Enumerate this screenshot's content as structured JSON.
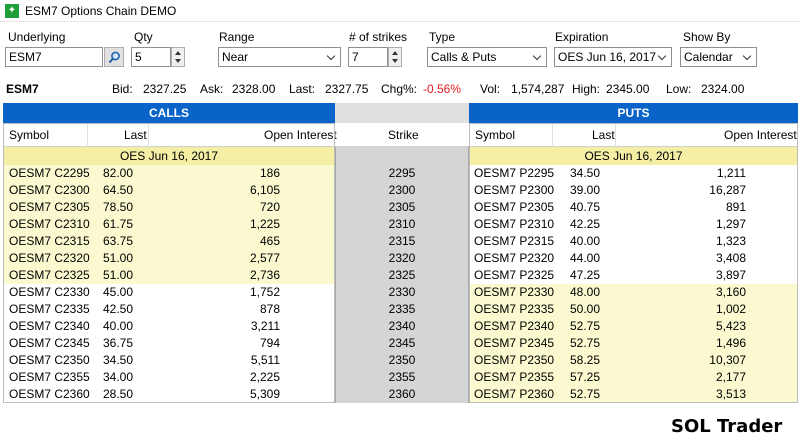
{
  "window": {
    "title": "ESM7 Options Chain DEMO",
    "icon": "app-icon"
  },
  "controls": {
    "underlying": {
      "label": "Underlying",
      "value": "ESM7"
    },
    "qty": {
      "label": "Qty",
      "value": "5"
    },
    "range": {
      "label": "Range",
      "value": "Near"
    },
    "strikes": {
      "label": "# of strikes",
      "value": "7"
    },
    "type": {
      "label": "Type",
      "value": "Calls & Puts"
    },
    "expiration": {
      "label": "Expiration",
      "value": "OES Jun 16, 2017"
    },
    "show_by": {
      "label": "Show By",
      "value": "Calendar"
    }
  },
  "quote": {
    "symbol": "ESM7",
    "bid_label": "Bid:",
    "bid": "2327.25",
    "ask_label": "Ask:",
    "ask": "2328.00",
    "last_label": "Last:",
    "last": "2327.75",
    "chg_label": "Chg%:",
    "chg": "-0.56%",
    "vol_label": "Vol:",
    "vol": "1,574,287",
    "high_label": "High:",
    "high": "2345.00",
    "low_label": "Low:",
    "low": "2324.00"
  },
  "headers": {
    "calls": "CALLS",
    "puts": "PUTS",
    "symbol": "Symbol",
    "last": "Last",
    "open_interest": "Open Interest",
    "strike": "Strike"
  },
  "expiry_label": "OES Jun 16, 2017",
  "rows": [
    {
      "strike": "2295",
      "call_symbol": "OESM7 C2295",
      "call_last": "82.00",
      "call_oi": "186",
      "put_symbol": "OESM7 P2295",
      "put_last": "34.50",
      "put_oi": "1,211"
    },
    {
      "strike": "2300",
      "call_symbol": "OESM7 C2300",
      "call_last": "64.50",
      "call_oi": "6,105",
      "put_symbol": "OESM7 P2300",
      "put_last": "39.00",
      "put_oi": "16,287"
    },
    {
      "strike": "2305",
      "call_symbol": "OESM7 C2305",
      "call_last": "78.50",
      "call_oi": "720",
      "put_symbol": "OESM7 P2305",
      "put_last": "40.75",
      "put_oi": "891"
    },
    {
      "strike": "2310",
      "call_symbol": "OESM7 C2310",
      "call_last": "61.75",
      "call_oi": "1,225",
      "put_symbol": "OESM7 P2310",
      "put_last": "42.25",
      "put_oi": "1,297"
    },
    {
      "strike": "2315",
      "call_symbol": "OESM7 C2315",
      "call_last": "63.75",
      "call_oi": "465",
      "put_symbol": "OESM7 P2315",
      "put_last": "40.00",
      "put_oi": "1,323"
    },
    {
      "strike": "2320",
      "call_symbol": "OESM7 C2320",
      "call_last": "51.00",
      "call_oi": "2,577",
      "put_symbol": "OESM7 P2320",
      "put_last": "44.00",
      "put_oi": "3,408"
    },
    {
      "strike": "2325",
      "call_symbol": "OESM7 C2325",
      "call_last": "51.00",
      "call_oi": "2,736",
      "put_symbol": "OESM7 P2325",
      "put_last": "47.25",
      "put_oi": "3,897"
    },
    {
      "strike": "2330",
      "call_symbol": "OESM7 C2330",
      "call_last": "45.00",
      "call_oi": "1,752",
      "put_symbol": "OESM7 P2330",
      "put_last": "48.00",
      "put_oi": "3,160"
    },
    {
      "strike": "2335",
      "call_symbol": "OESM7 C2335",
      "call_last": "42.50",
      "call_oi": "878",
      "put_symbol": "OESM7 P2335",
      "put_last": "50.00",
      "put_oi": "1,002"
    },
    {
      "strike": "2340",
      "call_symbol": "OESM7 C2340",
      "call_last": "40.00",
      "call_oi": "3,211",
      "put_symbol": "OESM7 P2340",
      "put_last": "52.75",
      "put_oi": "5,423"
    },
    {
      "strike": "2345",
      "call_symbol": "OESM7 C2345",
      "call_last": "36.75",
      "call_oi": "794",
      "put_symbol": "OESM7 P2345",
      "put_last": "52.75",
      "put_oi": "1,496"
    },
    {
      "strike": "2350",
      "call_symbol": "OESM7 C2350",
      "call_last": "34.50",
      "call_oi": "5,511",
      "put_symbol": "OESM7 P2350",
      "put_last": "58.25",
      "put_oi": "10,307"
    },
    {
      "strike": "2355",
      "call_symbol": "OESM7 C2355",
      "call_last": "34.00",
      "call_oi": "2,225",
      "put_symbol": "OESM7 P2355",
      "put_last": "57.25",
      "put_oi": "2,177"
    },
    {
      "strike": "2360",
      "call_symbol": "OESM7 C2360",
      "call_last": "28.50",
      "call_oi": "5,309",
      "put_symbol": "OESM7 P2360",
      "put_last": "52.75",
      "put_oi": "3,513"
    }
  ],
  "brand": "SOL Trader",
  "colors": {
    "header_blue": "#0a63c9",
    "in_the_money": "#fbf9cf",
    "expiry_band": "#f4efa5",
    "strike_column": "#d5d5d5",
    "negative": "#e02020"
  }
}
